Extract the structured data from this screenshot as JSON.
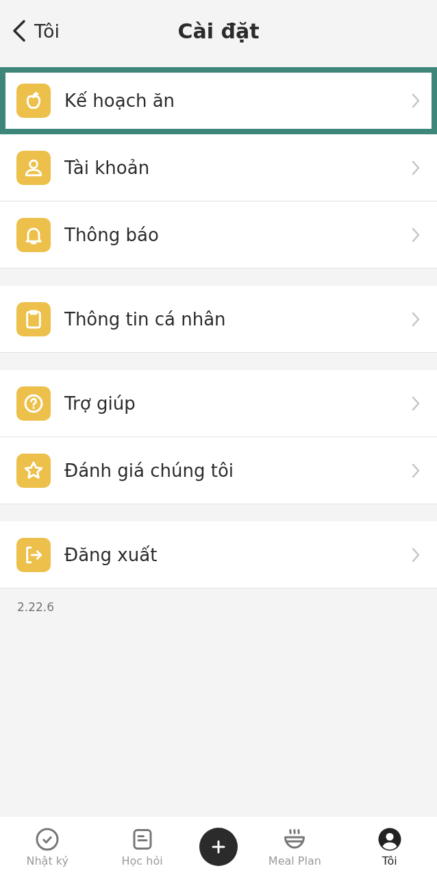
{
  "header": {
    "back_label": "Tôi",
    "title": "Cài đặt"
  },
  "groups": [
    {
      "items": [
        {
          "label": "Kế hoạch ăn",
          "kind": "apple",
          "highlighted": true
        },
        {
          "label": "Tài khoản",
          "kind": "person",
          "highlighted": false
        },
        {
          "label": "Thông báo",
          "kind": "bell",
          "highlighted": false
        }
      ]
    },
    {
      "items": [
        {
          "label": "Thông tin cá nhân",
          "kind": "clipboard",
          "highlighted": false
        }
      ]
    },
    {
      "items": [
        {
          "label": "Trợ giúp",
          "kind": "help",
          "highlighted": false
        },
        {
          "label": "Đánh giá chúng tôi",
          "kind": "star",
          "highlighted": false
        }
      ]
    },
    {
      "items": [
        {
          "label": "Đăng xuất",
          "kind": "logout",
          "highlighted": false
        }
      ]
    }
  ],
  "version": "2.22.6",
  "tab_bar": [
    {
      "label": "Nhật ký",
      "kind": "check",
      "selected": false
    },
    {
      "label": "Học hỏi",
      "kind": "note",
      "selected": false
    },
    {
      "kind": "plus",
      "selected": false
    },
    {
      "label": "Meal Plan",
      "kind": "bowl",
      "selected": false
    },
    {
      "label": "Tôi",
      "kind": "user",
      "selected": true
    }
  ]
}
